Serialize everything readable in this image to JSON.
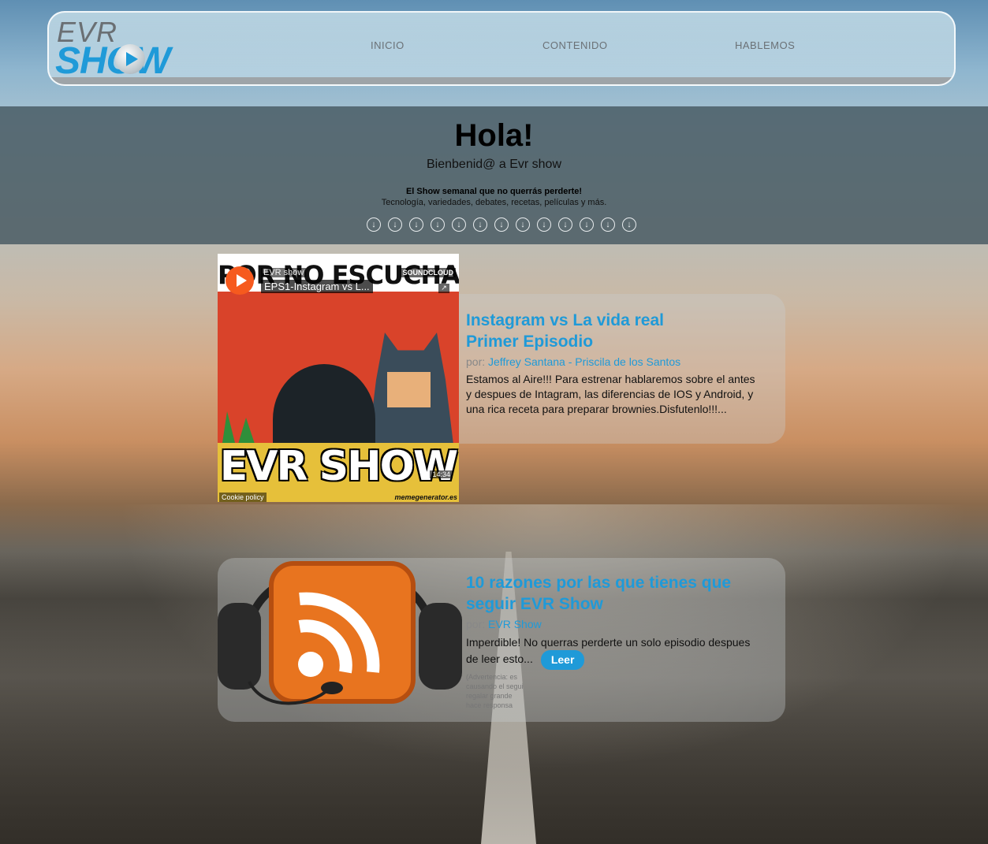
{
  "header": {
    "logo_top": "EVR",
    "logo_bottom": "SHOW",
    "nav": [
      "INICIO",
      "CONTENIDO",
      "HABLEMOS"
    ]
  },
  "hero": {
    "title": "Hola!",
    "subtitle": "Bienbenid@ a Evr show",
    "tagline_bold": "El Show semanal que no querrás perderte!",
    "tagline": "Tecnología, variedades, debates, recetas, películas y más."
  },
  "posts": [
    {
      "player": {
        "artist": "EVR show",
        "track": "EPS1-Instagram vs L...",
        "provider": "SOUNDCLOUD",
        "duration": "14:34",
        "cookie": "Cookie policy"
      },
      "meme_top": "POR NO ESCUCHAR",
      "meme_bottom": "EVR SHOW",
      "meme_credit": "memegenerator.es",
      "title_line1": "Instagram vs La vida real",
      "title_line2": "Primer Episodio",
      "by_label": "por:",
      "authors": "Jeffrey Santana - Priscila de los Santos",
      "body": "Estamos al Aire!!! Para estrenar hablaremos sobre el antes y despues de Intagram, las diferencias de IOS y Android, y una rica receta para preparar brownies.Disfutenlo!!!..."
    },
    {
      "title_line1": "10 razones por las que tienes que",
      "title_line2": "seguir EVR Show",
      "by_label": "por:",
      "authors": "EVR Show",
      "body": "Imperdible! No querras perderte un solo episodio despues de leer esto...",
      "button": "Leer",
      "warning_lines": [
        "(Advertencia: es",
        "causando el segui",
        "regalar grande",
        "hace responsa"
      ]
    }
  ],
  "colors": {
    "accent": "#1f9ad8",
    "soundcloud": "#f65a1e"
  }
}
